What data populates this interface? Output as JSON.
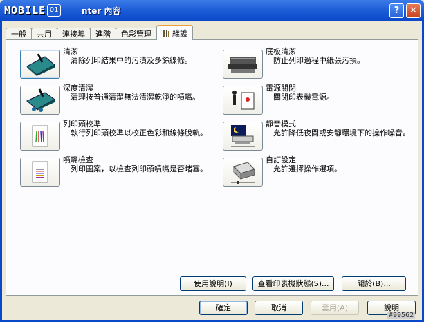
{
  "window": {
    "logo_text": "MOBILE",
    "logo_box": "01",
    "title": "nter 內容",
    "help_label": "?",
    "close_label": "✕"
  },
  "tabs": [
    {
      "label": "一般"
    },
    {
      "label": "共用"
    },
    {
      "label": "連接埠"
    },
    {
      "label": "進階"
    },
    {
      "label": "色彩管理"
    },
    {
      "label": "維護",
      "active": true
    }
  ],
  "maintenance": {
    "left": [
      {
        "title": "清潔",
        "desc": "清除列印結果中的污漬及多餘線條。",
        "icon": "cleaning-icon"
      },
      {
        "title": "深度清潔",
        "desc": "清理按普通清潔無法清潔乾淨的噴嘴。",
        "icon": "deep-cleaning-icon"
      },
      {
        "title": "列印頭校準",
        "desc": "執行列印頭校準以校正色彩和線條脫軌。",
        "icon": "print-head-alignment-icon"
      },
      {
        "title": "噴嘴檢查",
        "desc": "列印圖案，以檢查列印頭噴嘴是否堵塞。",
        "icon": "nozzle-check-icon"
      }
    ],
    "right": [
      {
        "title": "底板清潔",
        "desc": "防止列印過程中紙張污損。",
        "icon": "bottom-plate-cleaning-icon"
      },
      {
        "title": "電源關閉",
        "desc": "關閉印表機電源。",
        "icon": "power-off-icon"
      },
      {
        "title": "靜音模式",
        "desc": "允許降低夜間或安靜環境下的操作噪音。",
        "icon": "quiet-mode-icon"
      },
      {
        "title": "自訂設定",
        "desc": "允許選擇操作選項。",
        "icon": "custom-settings-icon"
      }
    ]
  },
  "panel_buttons": {
    "help": "使用說明(I)",
    "status": "查看印表機狀態(S)...",
    "about": "關於(B)..."
  },
  "dialog_buttons": {
    "ok": "確定",
    "cancel": "取消",
    "apply": "套用(A)",
    "help": "說明"
  },
  "watermark": "#99562"
}
